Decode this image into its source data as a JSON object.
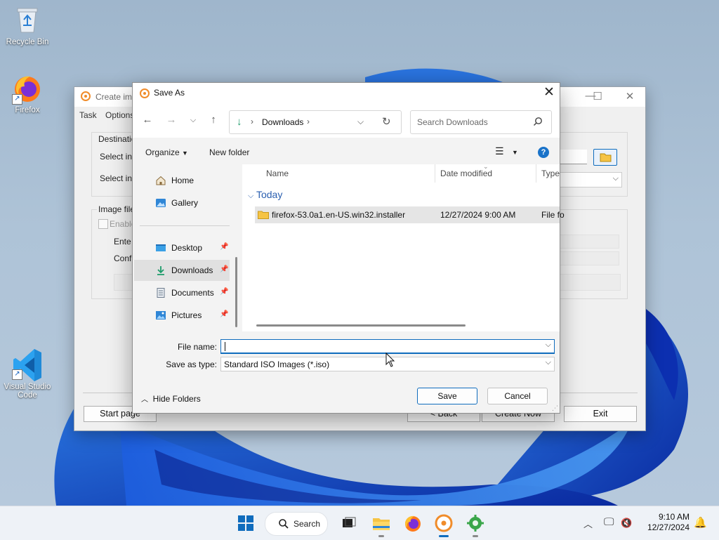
{
  "desktop": {
    "icons": [
      {
        "label": "Recycle Bin",
        "icon": "recycle-bin-icon"
      },
      {
        "label": "Firefox",
        "icon": "firefox-icon"
      },
      {
        "label": "Visual Studio Code",
        "icon": "vscode-icon"
      }
    ]
  },
  "bg_window": {
    "title": "Create ima",
    "menu": [
      "Task",
      "Options"
    ],
    "labels": {
      "destination": "Destinatio",
      "select1": "Select in",
      "select2": "Select in",
      "image_file": "Image file",
      "enable": "Enable",
      "enter": "Ente",
      "confirm": "Confi"
    },
    "buttons": {
      "start_page": "Start page",
      "back": "< Back",
      "create_now": "Create Now",
      "exit": "Exit"
    }
  },
  "dialog": {
    "title": "Save As",
    "address": {
      "crumb": "Downloads"
    },
    "search_placeholder": "Search Downloads",
    "commands": {
      "organize": "Organize",
      "new_folder": "New folder"
    },
    "nav": [
      {
        "label": "Home",
        "icon": "home-icon",
        "pinned": false
      },
      {
        "label": "Gallery",
        "icon": "gallery-icon",
        "pinned": false
      },
      {
        "label": "Desktop",
        "icon": "desktop-icon",
        "pinned": true
      },
      {
        "label": "Downloads",
        "icon": "downloads-icon",
        "pinned": true,
        "selected": true
      },
      {
        "label": "Documents",
        "icon": "documents-icon",
        "pinned": true
      },
      {
        "label": "Pictures",
        "icon": "pictures-icon",
        "pinned": true
      }
    ],
    "columns": [
      "Name",
      "Date modified",
      "Type"
    ],
    "group": "Today",
    "files": [
      {
        "name": "firefox-53.0a1.en-US.win32.installer",
        "date_modified": "12/27/2024 9:00 AM",
        "type": "File fo"
      }
    ],
    "file_name_label": "File name:",
    "file_name_value": "",
    "save_type_label": "Save as type:",
    "save_type_value": "Standard ISO Images (*.iso)",
    "hide_folders": "Hide Folders",
    "save": "Save",
    "cancel": "Cancel"
  },
  "taskbar": {
    "search": "Search",
    "time": "9:10 AM",
    "date": "12/27/2024"
  },
  "colors": {
    "accent": "#0f6cbd",
    "folder": "#f6c445",
    "app_orange": "#f08c2a"
  }
}
